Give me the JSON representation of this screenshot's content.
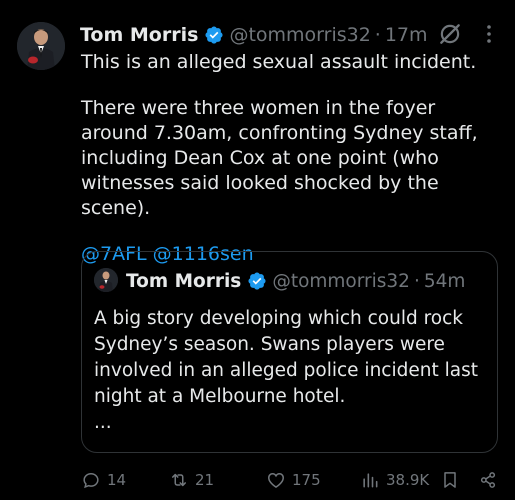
{
  "tweet": {
    "author_name": "Tom Morris",
    "handle": "@tommorris32",
    "separator": "·",
    "time": "17m",
    "more_label": "⋮",
    "paragraphs": [
      "This is an alleged sexual assault incident.",
      "There were three women in the foyer around 7.30am, confronting Sydney staff, including Dean Cox at one point (who witnesses said looked shocked by the scene)."
    ],
    "mentions": [
      "@7AFL",
      "@1116sen"
    ]
  },
  "quoted_tweet": {
    "author_name": "Tom Morris",
    "handle": "@tommorris32",
    "separator": "·",
    "time": "54m",
    "text": "A big story developing which could rock Sydney’s season. Swans players were involved in an alleged police incident last night at a Melbourne hotel.",
    "ellipsis": "..."
  },
  "actions": {
    "replies": "14",
    "reposts": "21",
    "likes": "175",
    "views": "38.9K"
  },
  "colors": {
    "background": "#000000",
    "text": "#e7e9ea",
    "muted": "#71767b",
    "link": "#1d9bf0",
    "verified": "#1d9bf0",
    "border": "#2f3336"
  },
  "icons": {
    "verified": "verified-badge-icon",
    "grok": "grok-icon",
    "reply": "reply-icon",
    "repost": "repost-icon",
    "like": "heart-icon",
    "views": "views-icon",
    "bookmark": "bookmark-icon",
    "share": "share-icon"
  }
}
